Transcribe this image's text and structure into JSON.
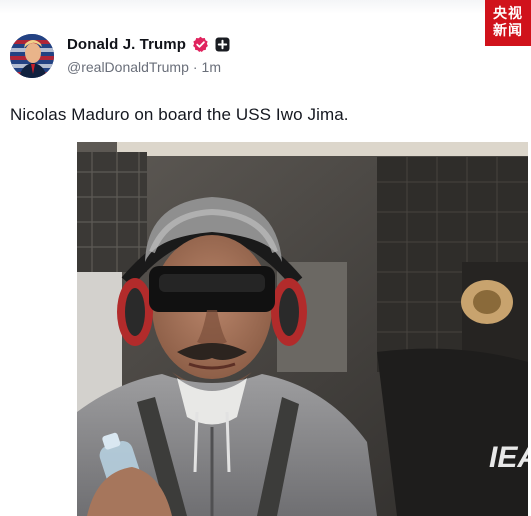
{
  "post": {
    "author": {
      "display_name": "Donald J. Trump",
      "handle": "@realDonaldTrump",
      "separator": "·",
      "time": "1m",
      "avatar_icon": "flag-portrait-avatar",
      "verified_icon": "verified-badge-icon",
      "verified_color": "#e0245e",
      "extra_icon": "plus-badge-icon"
    },
    "text": "Nicolas Maduro on board the USS Iwo Jima.",
    "photo": {
      "visible_text": "IEA"
    }
  },
  "watermark": {
    "line1": "央视",
    "line2": "新闻",
    "color": "#d0121b"
  }
}
